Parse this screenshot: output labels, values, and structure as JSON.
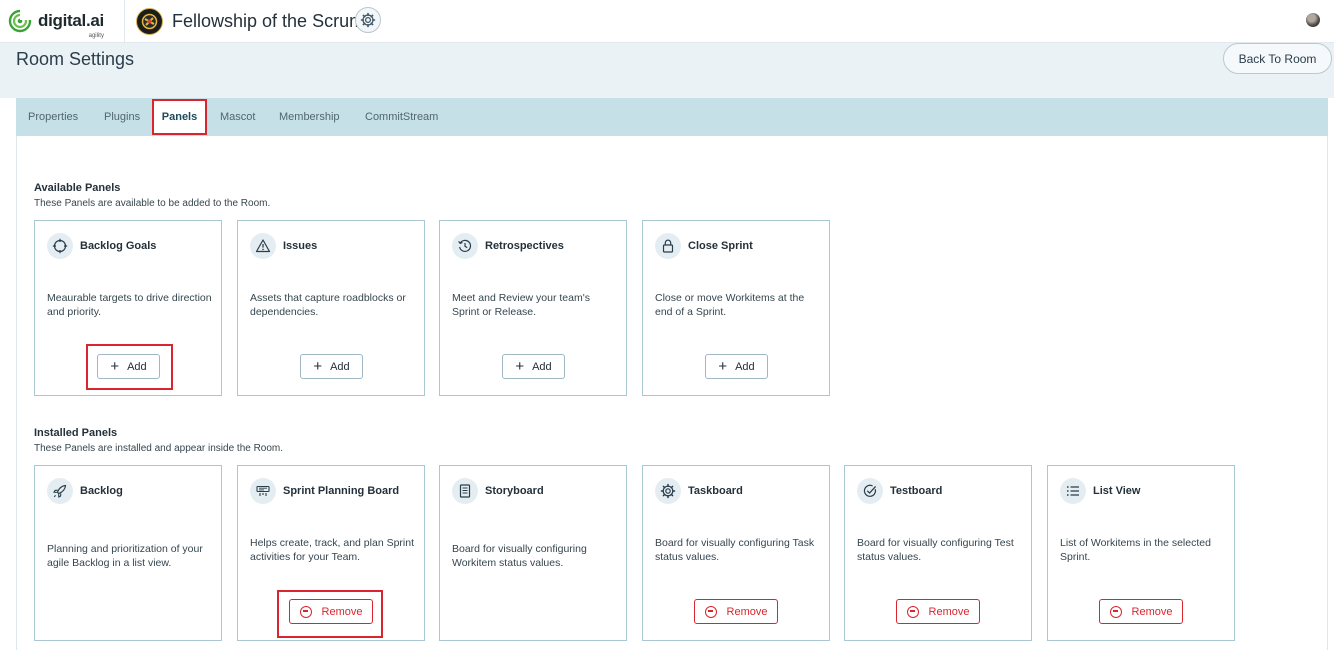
{
  "topbar": {
    "brand_word": "digital.ai",
    "brand_sub": "agility",
    "team_name": "Fellowship of the Scrum"
  },
  "page": {
    "title": "Room Settings",
    "back_label": "Back To Room"
  },
  "tabs": [
    {
      "label": "Properties"
    },
    {
      "label": "Plugins"
    },
    {
      "label": "Panels",
      "active": true
    },
    {
      "label": "Mascot"
    },
    {
      "label": "Membership"
    },
    {
      "label": "CommitStream"
    }
  ],
  "available": {
    "title": "Available Panels",
    "subtitle": "These Panels are available to be added to the Room.",
    "add_label": "Add",
    "cards": [
      {
        "title": "Backlog Goals",
        "icon": "target-icon",
        "desc": "Meaurable targets to drive direction and priority."
      },
      {
        "title": "Issues",
        "icon": "warning-icon",
        "desc": "Assets that capture roadblocks or dependencies."
      },
      {
        "title": "Retrospectives",
        "icon": "history-icon",
        "desc": "Meet and Review your team's Sprint or Release."
      },
      {
        "title": "Close Sprint",
        "icon": "lock-icon",
        "desc": "Close or move Workitems at the end of a Sprint."
      }
    ]
  },
  "installed": {
    "title": "Installed Panels",
    "subtitle": "These Panels are installed and appear inside the Room.",
    "remove_label": "Remove",
    "cards": [
      {
        "title": "Backlog",
        "icon": "rocket-icon",
        "desc": "Planning and prioritization of your agile Backlog in a list view.",
        "removable": false
      },
      {
        "title": "Sprint Planning Board",
        "icon": "planning-board-icon",
        "desc": "Helps create, track, and plan Sprint activities for your Team.",
        "removable": true
      },
      {
        "title": "Storyboard",
        "icon": "storyboard-icon",
        "desc": "Board for visually configuring Workitem status values.",
        "removable": false
      },
      {
        "title": "Taskboard",
        "icon": "gear-icon",
        "desc": "Board for visually configuring Task status values.",
        "removable": true
      },
      {
        "title": "Testboard",
        "icon": "check-circle-icon",
        "desc": "Board for visually configuring Test status values.",
        "removable": true
      },
      {
        "title": "List View",
        "icon": "list-icon",
        "desc": "List of Workitems in the selected Sprint.",
        "removable": true
      }
    ]
  },
  "colors": {
    "accent_red": "#d9262e",
    "tabbar_bg": "#c5e0e7",
    "header_bg": "#eaf2f6",
    "card_border": "#aac8d4"
  }
}
